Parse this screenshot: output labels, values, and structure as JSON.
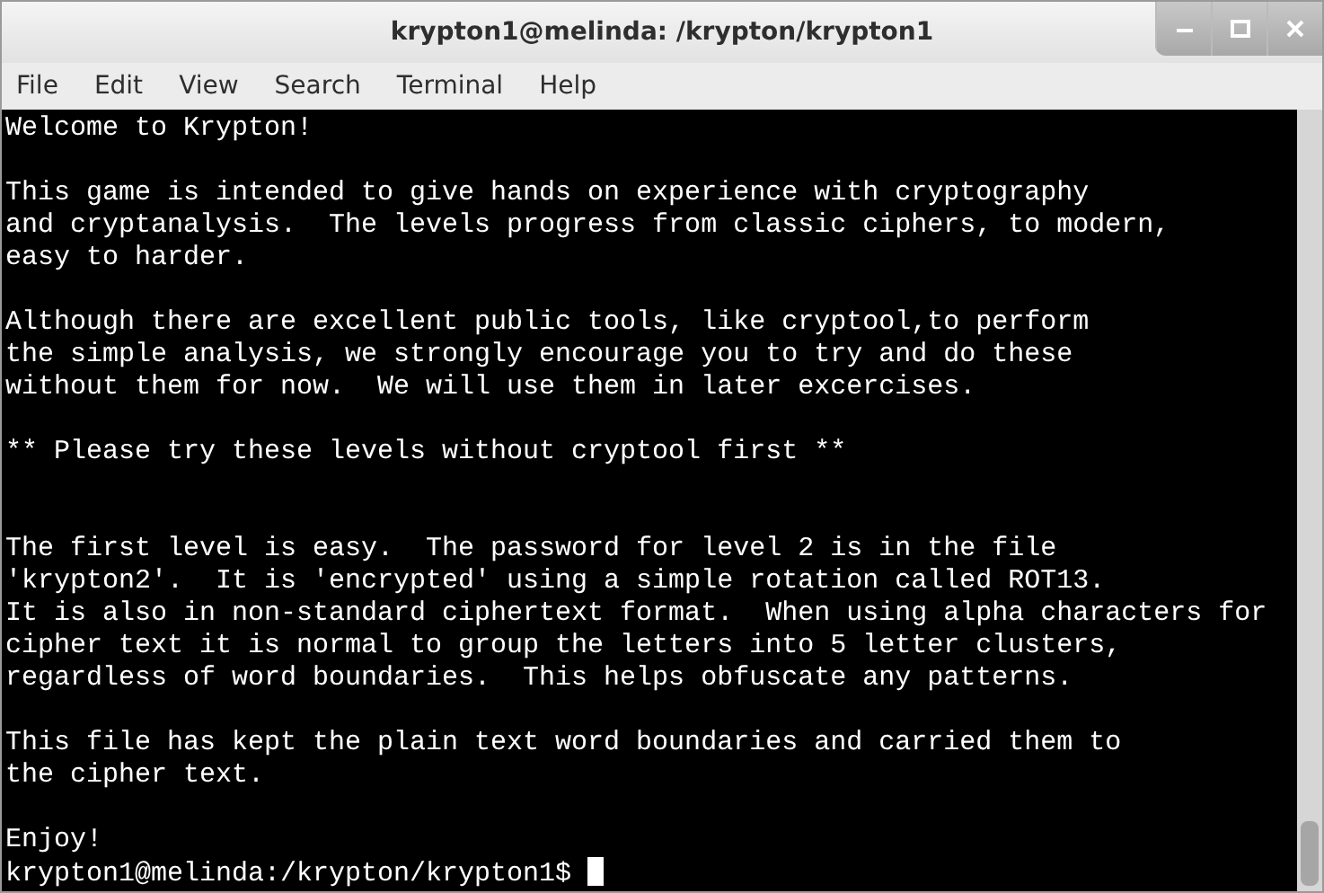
{
  "window": {
    "title": "krypton1@melinda: /krypton/krypton1"
  },
  "menu": [
    "File",
    "Edit",
    "View",
    "Search",
    "Terminal",
    "Help"
  ],
  "terminal": {
    "lines": [
      {
        "kind": "text",
        "text": "Welcome to Krypton!"
      },
      {
        "kind": "blank"
      },
      {
        "kind": "text",
        "text": "This game is intended to give hands on experience with cryptography"
      },
      {
        "kind": "text",
        "text": "and cryptanalysis.  The levels progress from classic ciphers, to modern,"
      },
      {
        "kind": "text",
        "text": "easy to harder."
      },
      {
        "kind": "blank"
      },
      {
        "kind": "text",
        "text": "Although there are excellent public tools, like cryptool,to perform"
      },
      {
        "kind": "text",
        "text": "the simple analysis, we strongly encourage you to try and do these"
      },
      {
        "kind": "text",
        "text": "without them for now.  We will use them in later excercises."
      },
      {
        "kind": "blank"
      },
      {
        "kind": "text",
        "text": "** Please try these levels without cryptool first **"
      },
      {
        "kind": "blank"
      },
      {
        "kind": "blank"
      },
      {
        "kind": "text",
        "text": "The first level is easy.  The password for level 2 is in the file"
      },
      {
        "kind": "text",
        "text": "'krypton2'.  It is 'encrypted' using a simple rotation called ROT13."
      },
      {
        "kind": "text",
        "text": "It is also in non-standard ciphertext format.  When using alpha characters for"
      },
      {
        "kind": "text",
        "text": "cipher text it is normal to group the letters into 5 letter clusters,"
      },
      {
        "kind": "text",
        "text": "regardless of word boundaries.  This helps obfuscate any patterns."
      },
      {
        "kind": "blank"
      },
      {
        "kind": "text",
        "text": "This file has kept the plain text word boundaries and carried them to"
      },
      {
        "kind": "text",
        "text": "the cipher text."
      },
      {
        "kind": "blank"
      },
      {
        "kind": "text",
        "text": "Enjoy!"
      },
      {
        "kind": "prompt",
        "text": "krypton1@melinda:/krypton/krypton1$"
      }
    ]
  }
}
